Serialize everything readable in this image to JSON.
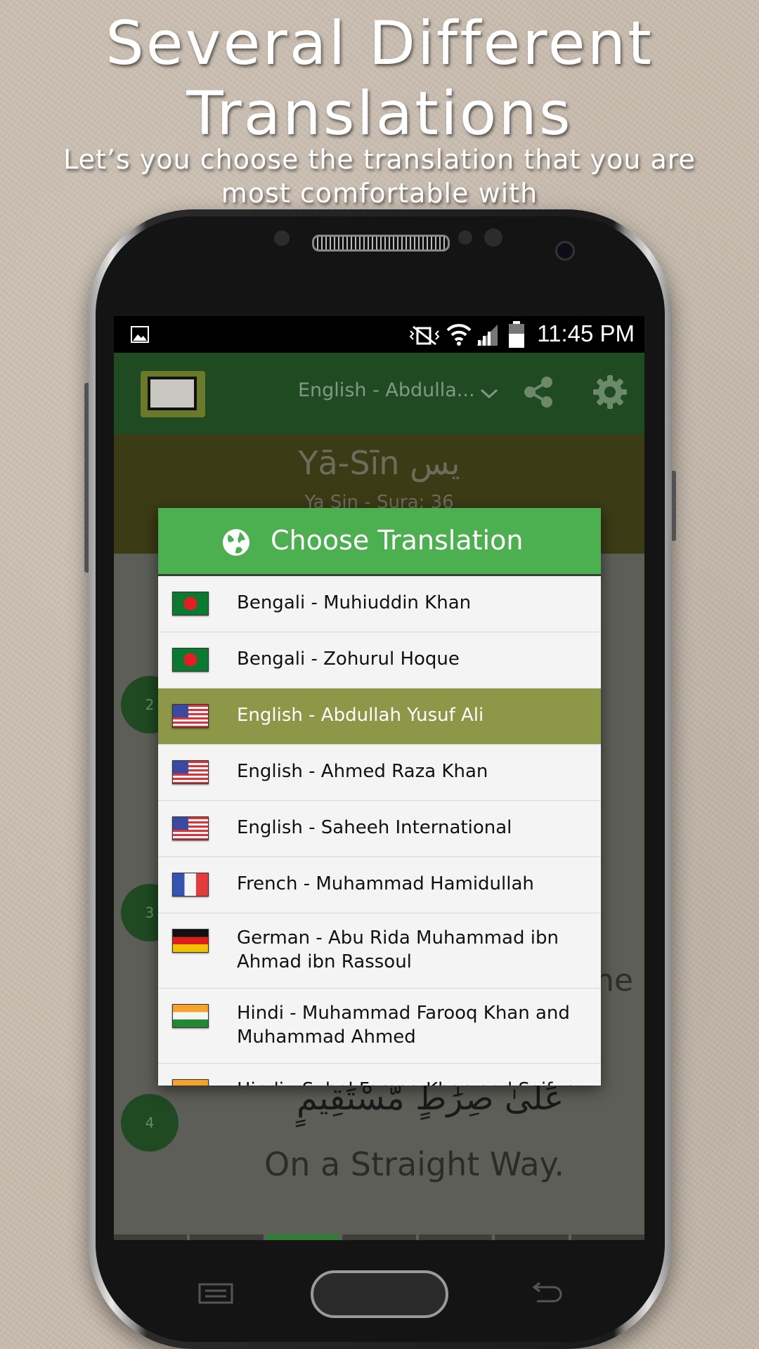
{
  "promo": {
    "title_line1": "Several Different",
    "title_line2": "Translations",
    "subtitle_line1": "Let’s you choose the translation that you are",
    "subtitle_line2": "most comfortable with"
  },
  "status_bar": {
    "time": "11:45 PM"
  },
  "app_bar": {
    "selected_translation": "English - Abdulla...",
    "icons": [
      "app-logo-icon",
      "chevron-down-icon",
      "share-icon",
      "gear-icon"
    ]
  },
  "sura": {
    "name": "Yā-Sīn يس",
    "info": "Ya Sin - Sura: 36"
  },
  "verses": {
    "badge2": "2",
    "badge3": "3",
    "badge4": "4",
    "verse3_tail": "he",
    "verse4_arabic": "عَلَىٰ صِرَٰطٍ مُّسْتَقِيمٍ",
    "verse4_translation": "On a Straight Way."
  },
  "dialog": {
    "title": "Choose Translation",
    "icon": "globe-icon",
    "accent_color": "#4caf50",
    "selected_color": "#8c9747",
    "items": [
      {
        "label": "Bengali - Muhiuddin Khan",
        "flag": "bangladesh-flag-icon"
      },
      {
        "label": "Bengali - Zohurul Hoque",
        "flag": "bangladesh-flag-icon"
      },
      {
        "label": "English - Abdullah Yusuf Ali",
        "flag": "usa-flag-icon",
        "selected": true
      },
      {
        "label": "English - Ahmed Raza Khan",
        "flag": "usa-flag-icon"
      },
      {
        "label": "English - Saheeh International",
        "flag": "usa-flag-icon"
      },
      {
        "label": "French - Muhammad Hamidullah",
        "flag": "france-flag-icon"
      },
      {
        "label": "German - Abu Rida Muhammad ibn Ahmad ibn Rassoul",
        "flag": "germany-flag-icon"
      },
      {
        "label": "Hindi - Muhammad Farooq Khan and Muhammad Ahmed",
        "flag": "india-flag-icon"
      },
      {
        "label": "Hindi - Suhel Farooq Khan and Saifur",
        "flag": "india-flag-icon"
      }
    ]
  }
}
